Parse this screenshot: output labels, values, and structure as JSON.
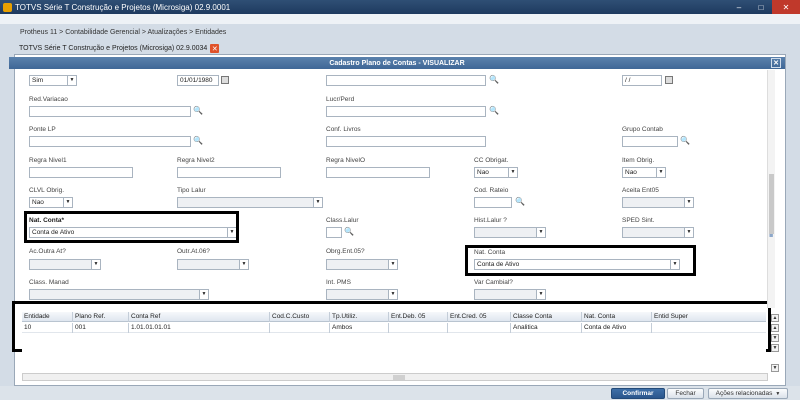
{
  "window": {
    "title": "TOTVS Série T Construção e Projetos (Microsiga) 02.9.0001",
    "minimize": "–",
    "maximize": "□",
    "close": "✕"
  },
  "breadcrumb": "Protheus 11 > Contabilidade Gerencial > Atualizações > Entidades",
  "tab": {
    "label": "TOTVS Série T Construção e Projetos (Microsiga) 02.9.0034",
    "close": "✕"
  },
  "dialog": {
    "title": "Cadastro Plano de Contas - VISUALIZAR",
    "close": "✕"
  },
  "form": {
    "row0": {
      "sel1": "Sim",
      "date1": "01/01/1980",
      "date2": "/ /"
    },
    "red_variacao": {
      "label": "Red.Variacao",
      "value": ""
    },
    "lucr_perd": {
      "label": "Lucr/Perd",
      "value": ""
    },
    "ponte_lp": {
      "label": "Ponte LP",
      "value": ""
    },
    "conf_livros": {
      "label": "Conf. Livros",
      "value": ""
    },
    "grupo_contab": {
      "label": "Grupo Contab",
      "value": ""
    },
    "regra_nivel1": {
      "label": "Regra Nivel1",
      "value": ""
    },
    "regra_nivel2": {
      "label": "Regra Nivel2",
      "value": ""
    },
    "regra_nivel0": {
      "label": "Regra NivelO",
      "value": ""
    },
    "cc_obrigat": {
      "label": "CC Obrigat.",
      "value": "Nao"
    },
    "item_obrig": {
      "label": "Item Obrig.",
      "value": "Nao"
    },
    "clvl_obrig": {
      "label": "CLVL Obrig.",
      "value": "Nao"
    },
    "tipo_lalur": {
      "label": "Tipo Lalur",
      "value": ""
    },
    "cod_rateio": {
      "label": "Cod. Rateio",
      "value": ""
    },
    "aceita_ent05": {
      "label": "Aceita Ent05",
      "value": ""
    },
    "nat_conta": {
      "label": "Nat. Conta*",
      "value": "Conta de Ativo"
    },
    "class_lalur": {
      "label": "Class.Lalur",
      "value": ""
    },
    "hist_lalur": {
      "label": "Hist.Lalur ?",
      "value": ""
    },
    "sped_sint": {
      "label": "SPED Sint.",
      "value": ""
    },
    "ac_outra_at": {
      "label": "Ac.Outra At?",
      "value": ""
    },
    "outr_at_06": {
      "label": "Outr.At.06?",
      "value": ""
    },
    "obrg_ent_05": {
      "label": "Obrg.Ent.05?",
      "value": ""
    },
    "nat_conta2": {
      "label": "Nat. Conta",
      "value": "Conta de Ativo"
    },
    "class_manad": {
      "label": "Class. Manad",
      "value": ""
    },
    "int_pms": {
      "label": "Int. PMS",
      "value": ""
    },
    "var_cambial": {
      "label": "Var Cambial?",
      "value": ""
    }
  },
  "grid": {
    "columns": [
      "Entidade",
      "Plano Ref.",
      "Conta Ref",
      "Cod.C.Custo",
      "Tp.Utiliz.",
      "Ent.Deb. 05",
      "Ent.Cred. 05",
      "Classe Conta",
      "Nat. Conta",
      "Entid Super"
    ],
    "rows": [
      [
        "10",
        "001",
        "1.01.01.01.01",
        "",
        "Ambos",
        "",
        "",
        "Analitica",
        "Conta de Ativo",
        ""
      ]
    ]
  },
  "buttons": {
    "confirm": "Confirmar",
    "close": "Fechar",
    "actions": "Ações relacionadas"
  }
}
